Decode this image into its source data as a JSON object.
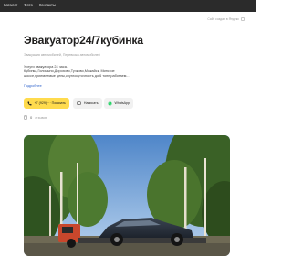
{
  "topnav": {
    "items": [
      "Каталог",
      "Фото",
      "Контакты"
    ]
  },
  "ad_note": "Сайт создан в Яндекс",
  "main": {
    "title": "Эвакуатор24/7кубинка",
    "categories": "Эвакуация автомобилей, Перевозка автомобилей",
    "description_lines": [
      "Услуги эвакуатора 24 часа.",
      "Кубинка,Голицыно,Дорохово,Тучково,Можайск, Минское",
      "шоссе,приемлемые цены,круглосуточность до 6 тонн,работаем..."
    ],
    "more_link": "Подробнее"
  },
  "actions": {
    "phone_label": "+7 (929) ··· Показать",
    "write_label": "Написать",
    "whatsapp_label": "WhatsApp"
  },
  "stats": {
    "count": "0",
    "label": "отзывов"
  },
  "colors": {
    "topbar": "#2b2b2b",
    "phone_button": "#ffdb4d",
    "secondary_button": "#f1f1f1",
    "link": "#3366cc",
    "whatsapp": "#25d366"
  },
  "icons": {
    "phone": "phone-icon",
    "write": "chat-icon",
    "whatsapp": "whatsapp-icon",
    "stats": "views-icon"
  }
}
